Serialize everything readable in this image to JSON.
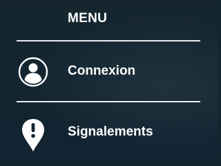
{
  "menu": {
    "title": "MENU",
    "items": [
      {
        "label": "Connexion",
        "icon": "user-avatar-icon"
      },
      {
        "label": "Signalements",
        "icon": "map-pin-alert-icon"
      }
    ]
  },
  "colors": {
    "background": "#132530",
    "text": "#ffffff",
    "divider": "#e9eef1"
  }
}
